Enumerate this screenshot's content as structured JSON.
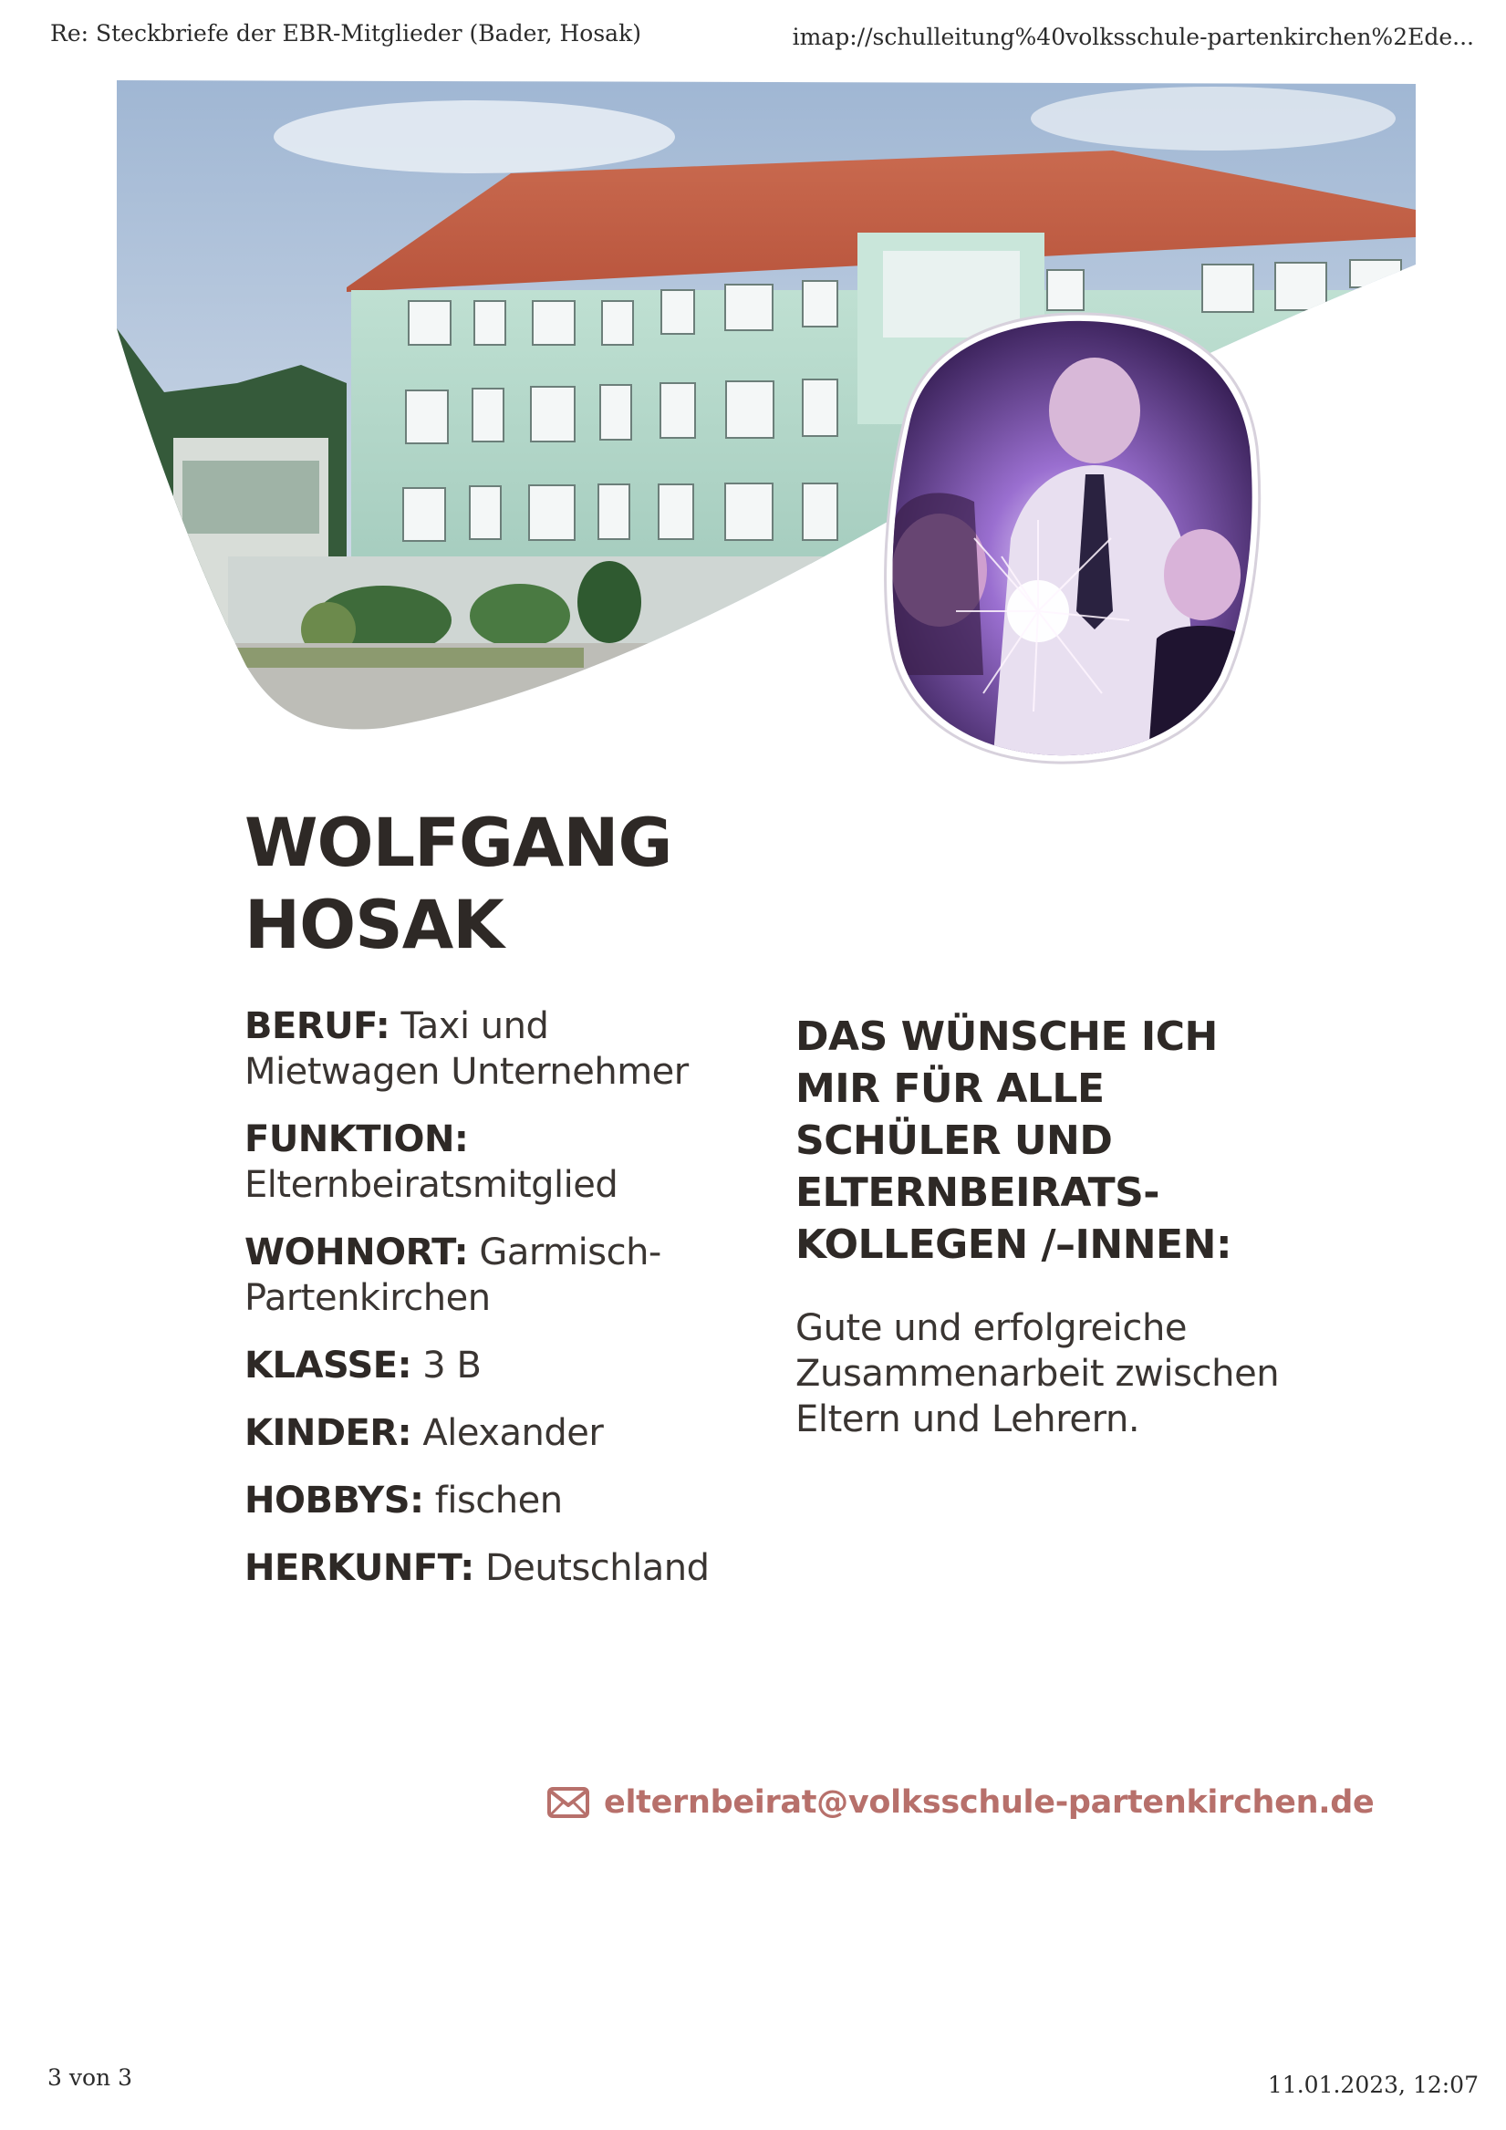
{
  "print_header": {
    "title": "Re: Steckbriefe der EBR-Mitglieder (Bader, Hosak)",
    "url": "imap://schulleitung%40volksschule-partenkirchen%2Ede..."
  },
  "print_footer": {
    "page": "3 von 3",
    "datetime": "11.01.2023, 12:07"
  },
  "profile": {
    "first_name": "WOLFGANG",
    "last_name": "HOSAK",
    "facts": [
      {
        "key": "BERUF:",
        "value": " Taxi und",
        "value_2": "Mietwagen Unternehmer"
      },
      {
        "key": "FUNKTION:",
        "value": "",
        "value_2": "Elternbeiratsmitglied"
      },
      {
        "key": "WOHNORT:",
        "value": " Garmisch-",
        "value_2": "Partenkirchen"
      },
      {
        "key": "KLASSE:",
        "value": " 3 B",
        "value_2": ""
      },
      {
        "key": "KINDER:",
        "value": " Alexander",
        "value_2": ""
      },
      {
        "key": "HOBBYS:",
        "value": " fischen",
        "value_2": ""
      },
      {
        "key": "HERKUNFT:",
        "value": " Deutschland",
        "value_2": ""
      }
    ]
  },
  "wish": {
    "heading_lines": [
      "DAS WÜNSCHE ICH",
      "MIR FÜR ALLE",
      "SCHÜLER UND",
      "ELTERNBEIRATS-",
      "KOLLEGEN /–INNEN:"
    ],
    "text_lines": [
      "Gute und erfolgreiche",
      "Zusammenarbeit zwischen",
      "Eltern und Lehrern."
    ]
  },
  "contact": {
    "icon": "envelope-icon",
    "email": "elternbeirat@volksschule-partenkirchen.de"
  },
  "colors": {
    "accent": "#b7706b",
    "heading": "#2e2926",
    "portrait_glow": "#7a4bb0"
  }
}
